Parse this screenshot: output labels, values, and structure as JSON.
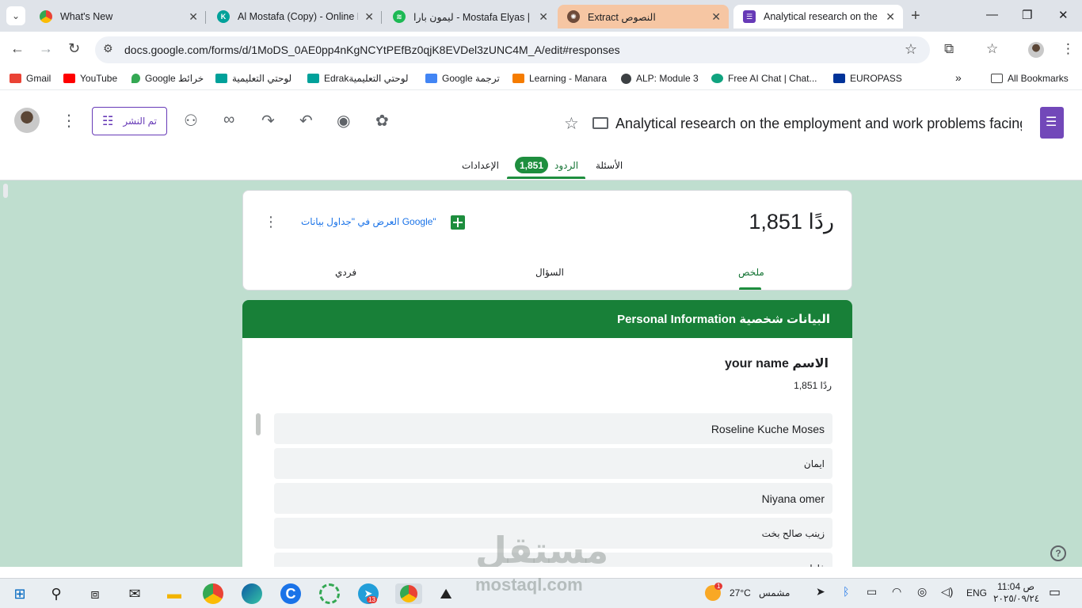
{
  "browser": {
    "tabs": [
      {
        "title": "What's New",
        "favicon": "chrome-icon",
        "state": "normal"
      },
      {
        "title": "Al Mostafa (Copy) - Online L",
        "favicon": "edrak-icon",
        "state": "normal"
      },
      {
        "title": "ليمون بارا - Mostafa Elyas | Spotify",
        "favicon": "spotify-icon",
        "state": "normal"
      },
      {
        "title": "Extract النصوص",
        "favicon": "openai-icon",
        "state": "highlighted"
      },
      {
        "title": "Analytical research on the employment",
        "favicon": "forms-icon",
        "state": "active"
      }
    ],
    "url": "docs.google.com/forms/d/1MoDS_0AE0pp4nKgNCYtPEfBz0qjK8EVDel3zUNC4M_A/edit#responses",
    "bookmarks": [
      {
        "label": "Gmail",
        "color": "#ea4335"
      },
      {
        "label": "YouTube",
        "color": "#ff0000"
      },
      {
        "label": "Google خرائط",
        "color": "#34a853"
      },
      {
        "label": "لوحتي التعليمية",
        "color": "#00a19a"
      },
      {
        "label": "Edrakلوحتي التعليمية",
        "color": "#00a19a"
      },
      {
        "label": "Google ترجمة",
        "color": "#4285f4"
      },
      {
        "label": "Learning - Manara",
        "color": "#f57c00"
      },
      {
        "label": "ALP: Module 3",
        "color": "#3c4043"
      },
      {
        "label": "Free AI Chat | Chat...",
        "color": "#10a37f"
      },
      {
        "label": "EUROPASS",
        "color": "#003399"
      }
    ],
    "overflow_label": "»",
    "all_bookmarks_label": "All Bookmarks"
  },
  "forms_header": {
    "publish_label": "تم النشر",
    "doc_title": "Analytical research on the employment and work problems facing",
    "tabs": {
      "questions": "الأسئلة",
      "responses": "الردود",
      "settings": "الإعدادات"
    },
    "responses_badge": "1,851"
  },
  "summary": {
    "count_label": "1,851 ردًا",
    "view_in_sheets": "العرض في \"جداول بيانات Google\"",
    "subtabs": {
      "summary": "ملخص",
      "question": "السؤال",
      "individual": "فردي"
    }
  },
  "section": {
    "title": "Personal Information البيانات شخصية"
  },
  "question": {
    "title": "your name الاسم",
    "count": "1,851 ردًا",
    "responses": [
      "Roseline Kuche Moses",
      "ايمان",
      "Niyana omer",
      "زينب صالح بخت",
      "فاطمة"
    ]
  },
  "watermark": {
    "main": "مستقل",
    "sub": "mostaql.com"
  },
  "taskbar": {
    "weather_temp": "27°C",
    "weather_label": "مشمس",
    "weather_badge": "1",
    "telegram_badge": "13",
    "language": "ENG",
    "time": "11:04 ص",
    "date": "٢٠٢٥/٠٩/٢٤"
  },
  "colors": {
    "accent_purple": "#673ab7",
    "forms_green": "#188038",
    "page_background": "#bfdecf"
  }
}
